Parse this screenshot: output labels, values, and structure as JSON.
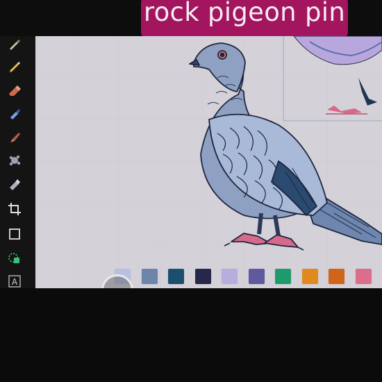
{
  "caption": "rock pigeon pin",
  "toolbar": {
    "tools": [
      {
        "name": "pen-icon",
        "color": "#c9c3a2"
      },
      {
        "name": "pencil-icon",
        "color": "#e6c24a"
      },
      {
        "name": "eraser-icon",
        "color": "#d06a4a"
      },
      {
        "name": "fill-icon",
        "color": "#7aa3e0"
      },
      {
        "name": "brush-icon",
        "color": "#d47a6a"
      },
      {
        "name": "smudge-icon",
        "color": "#9aa0b0"
      },
      {
        "name": "liquify-icon",
        "color": "#aab0bf"
      },
      {
        "name": "crop-icon",
        "color": "#e0e0e0"
      },
      {
        "name": "shape-icon",
        "color": "#e0e0e0"
      },
      {
        "name": "selection-icon",
        "color": "#3ac07a"
      },
      {
        "name": "text-icon",
        "color": "#d0d0d0"
      }
    ]
  },
  "palette": {
    "swatches": [
      {
        "name": "swatch-lavender",
        "color": "#b9bfe0"
      },
      {
        "name": "swatch-slate-blue",
        "color": "#6c85a8"
      },
      {
        "name": "swatch-teal-navy",
        "color": "#1c4f6e"
      },
      {
        "name": "swatch-dark-navy",
        "color": "#25284a"
      },
      {
        "name": "swatch-lilac",
        "color": "#b8aede"
      },
      {
        "name": "swatch-purple",
        "color": "#5f5aa0"
      },
      {
        "name": "swatch-green",
        "color": "#1f9a6a"
      },
      {
        "name": "swatch-orange",
        "color": "#e08a1e"
      },
      {
        "name": "swatch-dark-orange",
        "color": "#d0651a"
      },
      {
        "name": "swatch-pink",
        "color": "#dc6e8c"
      }
    ]
  },
  "colors": {
    "accent": "#a3155f",
    "canvas_bg": "#d4d2d8",
    "pigeon_body": "#8fa1c2",
    "pigeon_wing": "#a9b9d8",
    "pigeon_dark": "#2a4a70",
    "pigeon_feet": "#d66a8a"
  }
}
